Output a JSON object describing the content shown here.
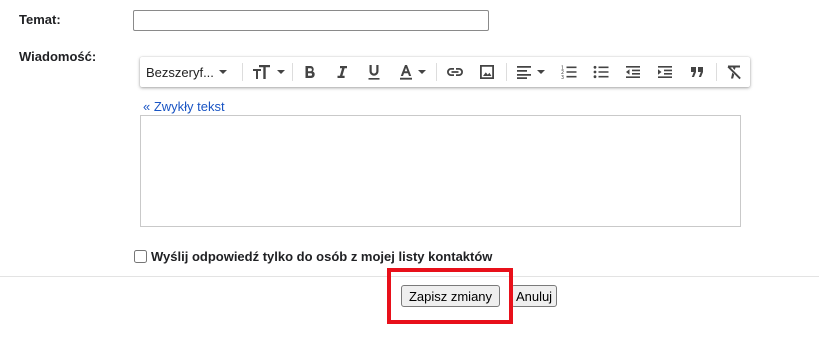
{
  "form": {
    "subject_label": "Temat:",
    "subject_value": "",
    "message_label": "Wiadomość:",
    "plain_text_link": "« Zwykły tekst",
    "contacts_only_label": "Wyślij odpowiedź tylko do osób z mojej listy kontaktów",
    "contacts_only_checked": false
  },
  "toolbar": {
    "font_family_label": "Bezszeryf...",
    "buttons": [
      {
        "name": "font-size-icon"
      },
      {
        "name": "bold-icon"
      },
      {
        "name": "italic-icon"
      },
      {
        "name": "underline-icon"
      },
      {
        "name": "text-color-icon"
      },
      {
        "name": "link-icon"
      },
      {
        "name": "image-icon"
      },
      {
        "name": "align-icon"
      },
      {
        "name": "numbered-list-icon"
      },
      {
        "name": "bulleted-list-icon"
      },
      {
        "name": "indent-less-icon"
      },
      {
        "name": "indent-more-icon"
      },
      {
        "name": "quote-icon"
      },
      {
        "name": "remove-formatting-icon"
      }
    ]
  },
  "actions": {
    "save_label": "Zapisz zmiany",
    "cancel_label": "Anuluj",
    "highlight_color": "#e8101a"
  }
}
